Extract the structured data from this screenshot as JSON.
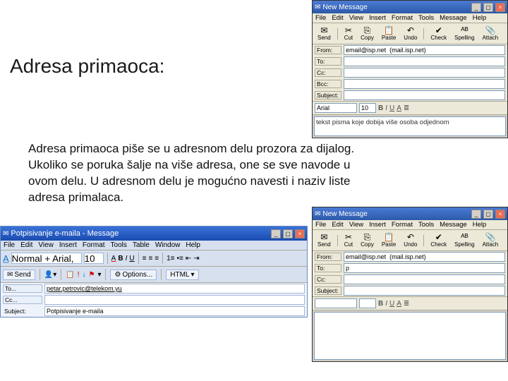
{
  "slide": {
    "title": "Adresa primaoca:",
    "body": "Adresa primaoca piše se u adresnom delu prozora za dijalog.\nUkoliko se poruka šalje na više adresa, one se sve navode u\novom delu. U adresnom delu je mogućno navesti i naziv liste\nadresa primalaca."
  },
  "oe": {
    "title": "New Message",
    "menu": [
      "File",
      "Edit",
      "View",
      "Insert",
      "Format",
      "Tools",
      "Message",
      "Help"
    ],
    "buttons": {
      "send": "Send",
      "cut": "Cut",
      "copy": "Copy",
      "paste": "Paste",
      "undo": "Undo",
      "check": "Check",
      "spelling": "Spelling",
      "attach": "Attach"
    },
    "labels": {
      "from": "From:",
      "to": "To:",
      "cc": "Cc:",
      "bcc": "Bcc:",
      "subject": "Subject:"
    },
    "from_value": "email@isp.net  (mail.isp.net)",
    "font": "Arial",
    "fontsize": "10",
    "sample_text": "tekst pisma koje dobija više osoba odjednom"
  },
  "oe2": {
    "to_value": "p"
  },
  "ol": {
    "title": "Potpisivanje e-maila - Message",
    "menu": [
      "File",
      "Edit",
      "View",
      "Insert",
      "Format",
      "Tools",
      "Table",
      "Window",
      "Help"
    ],
    "style": "Normal + Arial,",
    "fontsize": "10",
    "send": "Send",
    "options": "Options...",
    "html": "HTML",
    "labels": {
      "to": "To...",
      "cc": "Cc...",
      "subject": "Subject:"
    },
    "to_value": "petar.petrovic@telekom.yu",
    "subject_value": "Potpisivanje e-maila"
  }
}
